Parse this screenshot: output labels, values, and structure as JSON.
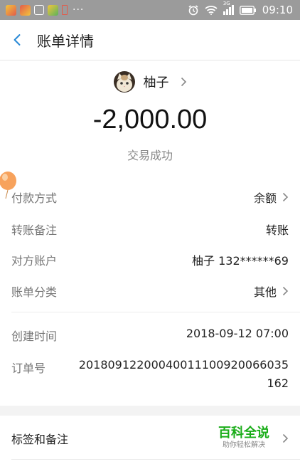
{
  "status_bar": {
    "time": "09:10",
    "network": "3G",
    "more": "···"
  },
  "nav": {
    "title": "账单详情"
  },
  "summary": {
    "user_name": "柚子",
    "amount": "-2,000.00",
    "status": "交易成功"
  },
  "details": [
    {
      "label": "付款方式",
      "value": "余额"
    },
    {
      "label": "转账备注",
      "value": "转账"
    },
    {
      "label": "对方账户",
      "value": "柚子 132******69"
    },
    {
      "label": "账单分类",
      "value": "其他"
    }
  ],
  "meta": {
    "created_label": "创建时间",
    "created_value": "2018-09-12 07:00",
    "order_label": "订单号",
    "order_value": "20180912200040011100920066035162"
  },
  "tags": {
    "label": "标签和备注",
    "promo_title": "百科全说",
    "promo_sub": "助你轻松解决"
  },
  "colors": {
    "accent_blue": "#2a8ad6",
    "promo_green": "#1aad19",
    "status_bar": "#9b9b9b"
  }
}
